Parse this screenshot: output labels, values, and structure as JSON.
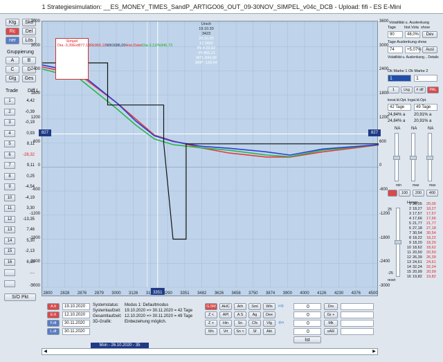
{
  "title": "1  Strategiesimulation:  __ES_MONEY_TIMES_SandP_ARTIGO06_OUT_09-30NOV_SIMPEL_v04c_DCB  -  Upload:  fifi  -  ES  E-Mini",
  "left_top_buttons": [
    "Ktg",
    "Sko",
    "Rc",
    "Del",
    "ner",
    "Lös"
  ],
  "gruppierung": {
    "label": "Gruppierung",
    "buttons": [
      "A",
      "B",
      "C",
      "D",
      "Glg",
      "Ges"
    ]
  },
  "trade_header": {
    "trade": "Trade",
    "diff": "Diff L"
  },
  "trades": [
    {
      "n": "1",
      "v": "4,42",
      "red": false
    },
    {
      "n": "2",
      "v": "-0,39",
      "red": false
    },
    {
      "n": "3",
      "v": "-0,19",
      "red": false
    },
    {
      "n": "4",
      "v": "0,93",
      "red": false
    },
    {
      "n": "5",
      "v": "8,11",
      "red": false
    },
    {
      "n": "6",
      "v": "-28,32",
      "red": true
    },
    {
      "n": "7",
      "v": "9,11",
      "red": false
    },
    {
      "n": "8",
      "v": "0,25",
      "red": false
    },
    {
      "n": "9",
      "v": "-4,54",
      "red": false
    },
    {
      "n": "10",
      "v": "-4,19",
      "red": false
    },
    {
      "n": "11",
      "v": "3,30",
      "red": false
    },
    {
      "n": "12",
      "v": "-13,35",
      "red": false
    },
    {
      "n": "13",
      "v": "7,46",
      "red": false
    },
    {
      "n": "14",
      "v": "5,30",
      "red": false
    },
    {
      "n": "15",
      "v": "-2,13",
      "red": false
    },
    {
      "n": "16",
      "v": "6,25",
      "red": false
    },
    {
      "n": "",
      "v": "....",
      "red": false
    },
    {
      "n": "",
      "v": "....",
      "red": false
    }
  ],
  "sci_label": "S/O  Pkt",
  "legend": {
    "title": "Simpel",
    "rows": [
      {
        "k": "Dia.",
        "v": "-3,39",
        "color": "#d22"
      },
      {
        "k": "Ext",
        "v": "877,18",
        "color": "#d22"
      },
      {
        "k": "Rk",
        "v": "966,18",
        "color": "#d22"
      },
      {
        "k": "Wtl",
        "v": "1686,00",
        "color": "#224"
      },
      {
        "k": "Hist.Datei",
        "v": "",
        "color": "#d22"
      },
      {
        "k": "Dia",
        "v": "-3,11",
        "color": "#2a2"
      },
      {
        "k": "Pk",
        "v": "846,73",
        "color": "#2a2"
      }
    ]
  },
  "cursor_info": {
    "title": "Ursch",
    "date": "19.10.20",
    "value": "3423",
    "lines": [
      "26.10.20",
      "12 3492",
      "Pk 4 23,62",
      "-Pt 455,13",
      "WTL 844,99",
      "BRP -139,04"
    ]
  },
  "chart_data": {
    "type": "line",
    "x_ticks": [
      "2800",
      "2828",
      "2876",
      "2879",
      "3000",
      "3126",
      "3128",
      "3290",
      "3351",
      "3482",
      "3626",
      "3658",
      "3750",
      "3874",
      "3900",
      "4000",
      "4126",
      "4230",
      "4376",
      "4500"
    ],
    "x_marker_label": "3351",
    "y_ticks_left": [
      "3600",
      "3000",
      "2400",
      "1800",
      "1200",
      "600",
      "0",
      "-600",
      "-1200",
      "-1800",
      "-2400",
      "-3000"
    ],
    "y_ticks_right": [
      "3600",
      "3000",
      "2400",
      "1800",
      "1200",
      "600",
      "0",
      "-600",
      "-1200",
      "-1800",
      "-2400",
      "-3000"
    ],
    "ylim": [
      -3000,
      3600
    ],
    "xlim": [
      2800,
      4600
    ],
    "h_marker_value": 827,
    "h_marker_label": "827",
    "series": [
      {
        "color": "#e23c3c",
        "x": [
          2800,
          3000,
          3200,
          3300,
          3400,
          3500,
          3650,
          3800,
          4000,
          4126,
          4300,
          4600
        ],
        "y": [
          2500,
          2300,
          1600,
          1200,
          800,
          650,
          480,
          350,
          250,
          250,
          380,
          550
        ]
      },
      {
        "color": "#2db34a",
        "x": [
          2800,
          3000,
          3200,
          3300,
          3400,
          3500,
          3650,
          3800,
          4000,
          4126,
          4300,
          4600
        ],
        "y": [
          2450,
          2200,
          1450,
          1050,
          700,
          560,
          480,
          420,
          300,
          260,
          420,
          560
        ]
      },
      {
        "color": "#2a3fd4",
        "x": [
          2800,
          3000,
          3200,
          3300,
          3400,
          3500,
          3650,
          3800,
          4000,
          4126,
          4300,
          4600
        ],
        "y": [
          2550,
          2350,
          1600,
          1150,
          780,
          640,
          520,
          470,
          380,
          300,
          450,
          560
        ]
      },
      {
        "color": "#111111",
        "x": [
          2800,
          3150,
          3150,
          3450,
          3450,
          3500,
          3500,
          3520,
          3570,
          3570,
          4600
        ],
        "y": [
          2600,
          2600,
          1550,
          1550,
          600,
          -1800,
          -1800,
          -1800,
          -1800,
          580,
          580
        ]
      }
    ]
  },
  "right_panel": {
    "vol_title": "Volatilität u. Auslenkung",
    "vol_sub": [
      "Tage",
      "hist.Vola",
      "show"
    ],
    "vol_vals": [
      "90",
      "48,0%",
      "Dev"
    ],
    "ausl_title": "Tage  Auslenkung  show",
    "ausl_vals": [
      "74",
      "+5,07%",
      "Ausl"
    ],
    "vol_note": "Volatilität u. Auslenkung... Details",
    "marker_title": "Ok Marke 1  Ok Marke 2",
    "marker_vals": [
      "1",
      "1"
    ],
    "buttons_row": [
      "1",
      "Lkg",
      "# dif",
      "PAL"
    ],
    "kreat_title": "kreat.Id.Opt.  Ingat.Id.Opt.",
    "kreat_vals": [
      "42 Tage",
      "49 Tage"
    ],
    "kreat_pct1": [
      "24,84% a",
      "20,91% a"
    ],
    "kreat_pct2": [
      "24,84% a",
      "20,91% a"
    ],
    "na_labels": [
      "NA",
      "NA",
      "NA"
    ],
    "min_labels": [
      "min",
      "max",
      "max"
    ],
    "bottom_btns": [
      "100",
      "200",
      "400"
    ],
    "gauge_labels": [
      "25",
      "-25",
      "reset"
    ],
    "hlist_title": "Hangs",
    "hlist": [
      [
        "1",
        "20,05",
        "20,05"
      ],
      [
        "2",
        "18,27",
        "18,27"
      ],
      [
        "3",
        "17,57",
        "17,57"
      ],
      [
        "4",
        "17,66",
        "17,66"
      ],
      [
        "5",
        "21,77",
        "21,77"
      ],
      [
        "6",
        "27,18",
        "27,18"
      ],
      [
        "7",
        "30,54",
        "30,54"
      ],
      [
        "8",
        "18,22",
        "18,22"
      ],
      [
        "9",
        "18,20",
        "18,20"
      ],
      [
        "10",
        "18,62",
        "18,62"
      ],
      [
        "11",
        "20,50",
        "20,50"
      ],
      [
        "12",
        "26,39",
        "26,39"
      ],
      [
        "13",
        "24,61",
        "24,61"
      ],
      [
        "14",
        "32,24",
        "32,24"
      ],
      [
        "15",
        "20,99",
        "20,99"
      ],
      [
        "16",
        "19,82",
        "19,82"
      ]
    ]
  },
  "bottom": {
    "dates": [
      {
        "btn": "A.lt",
        "date": "19.10.2020"
      },
      {
        "btn": "E.lt",
        "date": "12.10.2020"
      },
      {
        "btn": "F.dt",
        "date": "30.11.2020"
      },
      {
        "btn": "L.dt",
        "date": "30.11.2020"
      }
    ],
    "status_labels": [
      "Systemstatus:",
      "Systemlaufzeit:",
      "Gesamtlaufzeit:",
      "3D-Grafik:"
    ],
    "status_values": [
      "Modus 1: Defaultmodus",
      "19.10.2020 => 30.11.2020 = 42 Tage",
      "12.10.2020 => 30.11.2020 = 49 Tage",
      "Einbeziehung möglich."
    ],
    "grid_buttons": [
      [
        "G.5M",
        "AHC",
        "Arh",
        "Sml"
      ],
      [
        "Z <",
        "APl",
        "A S",
        "Ag"
      ],
      [
        "Z +",
        "Hin",
        "Sn",
        "Cfs"
      ],
      [
        "Mn",
        "Vrt",
        "Sn <",
        "Sf"
      ]
    ],
    "grid_buttons2": [
      "Wln",
      "Dee",
      "Vlg",
      "Akt"
    ],
    "io_buttons": [
      "Ist"
    ],
    "num_fields": [
      "0",
      "0",
      "0",
      "0"
    ],
    "side_btns": [
      "Drv",
      "Gr +",
      "Mk",
      "vAR"
    ],
    "date_label": "Mon - 26.10.2020 - 35"
  }
}
